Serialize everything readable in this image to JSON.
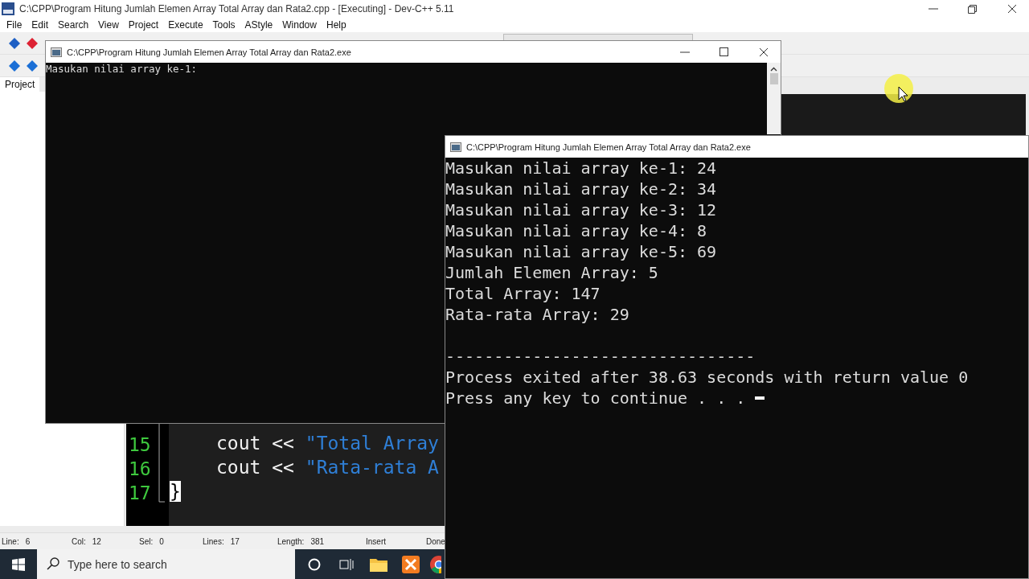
{
  "ide": {
    "title": "C:\\CPP\\Program Hitung Jumlah Elemen Array Total Array dan Rata2.cpp - [Executing] - Dev-C++ 5.11",
    "menu": [
      "File",
      "Edit",
      "Search",
      "View",
      "Project",
      "Execute",
      "Tools",
      "AStyle",
      "Window",
      "Help"
    ],
    "side_tab": "Project",
    "code_lines": [
      {
        "number": "15",
        "code": "cout << ",
        "string": "\"Total Array",
        "highlighted": false
      },
      {
        "number": "16",
        "code": "cout << ",
        "string": "\"Rata-rata A",
        "highlighted": false
      },
      {
        "number": "17",
        "code": "}",
        "highlighted": true
      }
    ],
    "status_bar": [
      {
        "label": "Line:",
        "value": "6"
      },
      {
        "label": "Col:",
        "value": "12"
      },
      {
        "label": "Sel:",
        "value": "0"
      },
      {
        "label": "Lines:",
        "value": "17"
      },
      {
        "label": "Length:",
        "value": "381"
      },
      {
        "label": "Insert"
      },
      {
        "label": "Done"
      }
    ]
  },
  "console_back": {
    "title": "C:\\CPP\\Program Hitung Jumlah Elemen Array Total Array dan Rata2.exe",
    "lines": [
      "Masukan nilai array ke-1:"
    ]
  },
  "console_front": {
    "title": "C:\\CPP\\Program Hitung Jumlah Elemen Array Total Array dan Rata2.exe",
    "lines": [
      {
        "kind": "text",
        "text": "Masukan nilai array ke-1: 24"
      },
      {
        "kind": "text",
        "text": "Masukan nilai array ke-2: 34"
      },
      {
        "kind": "text",
        "text": "Masukan nilai array ke-3: 12"
      },
      {
        "kind": "text",
        "text": "Masukan nilai array ke-4: 8"
      },
      {
        "kind": "text",
        "text": "Masukan nilai array ke-5: 69"
      },
      {
        "kind": "text",
        "text": "Jumlah Elemen Array: 5"
      },
      {
        "kind": "text",
        "text": "Total Array: 147"
      },
      {
        "kind": "text",
        "text": "Rata-rata Array: 29"
      },
      {
        "kind": "rule",
        "text": "--------------------------------"
      },
      {
        "kind": "text",
        "text": "Process exited after 38.63 seconds with return value 0"
      },
      {
        "kind": "prompt",
        "text": "Press any key to continue . . . "
      }
    ]
  },
  "taskbar": {
    "search_placeholder": "Type here to search"
  }
}
